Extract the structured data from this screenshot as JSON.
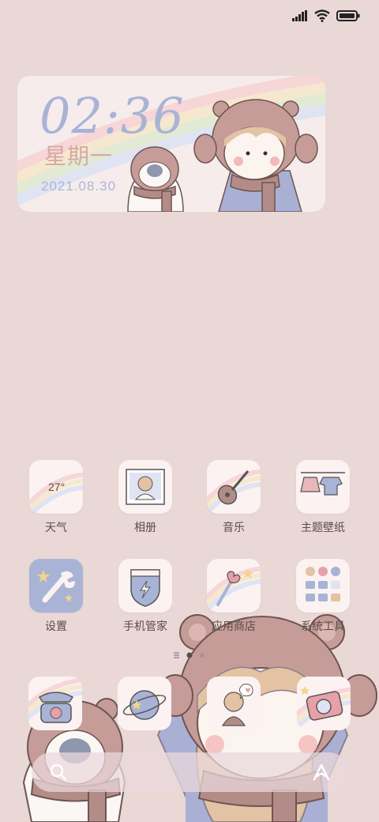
{
  "status_bar": {
    "signal_icon": "signal-icon",
    "wifi_icon": "wifi-icon",
    "battery_icon": "battery-icon"
  },
  "clock_widget": {
    "time": "02:36",
    "weekday": "星期一",
    "date": "2021.08.30"
  },
  "apps": [
    {
      "label": "天气",
      "icon": "weather-icon",
      "temp": "27°"
    },
    {
      "label": "相册",
      "icon": "gallery-icon"
    },
    {
      "label": "音乐",
      "icon": "music-icon"
    },
    {
      "label": "主题壁纸",
      "icon": "themes-icon"
    },
    {
      "label": "设置",
      "icon": "settings-icon"
    },
    {
      "label": "手机管家",
      "icon": "security-icon"
    },
    {
      "label": "应用商店",
      "icon": "app-store-icon"
    },
    {
      "label": "系统工具",
      "icon": "tools-folder-icon"
    }
  ],
  "dock": [
    {
      "icon": "phone-icon"
    },
    {
      "icon": "browser-icon"
    },
    {
      "icon": "messages-icon"
    },
    {
      "icon": "camera-icon"
    }
  ],
  "search_bar": {
    "search_icon": "search-icon",
    "assistant_icon": "assistant-icon"
  },
  "colors": {
    "background": "#ead8d6",
    "accent_blue": "#a9b3d6",
    "accent_pink": "#d6a9a6",
    "label": "#5b4b49"
  }
}
